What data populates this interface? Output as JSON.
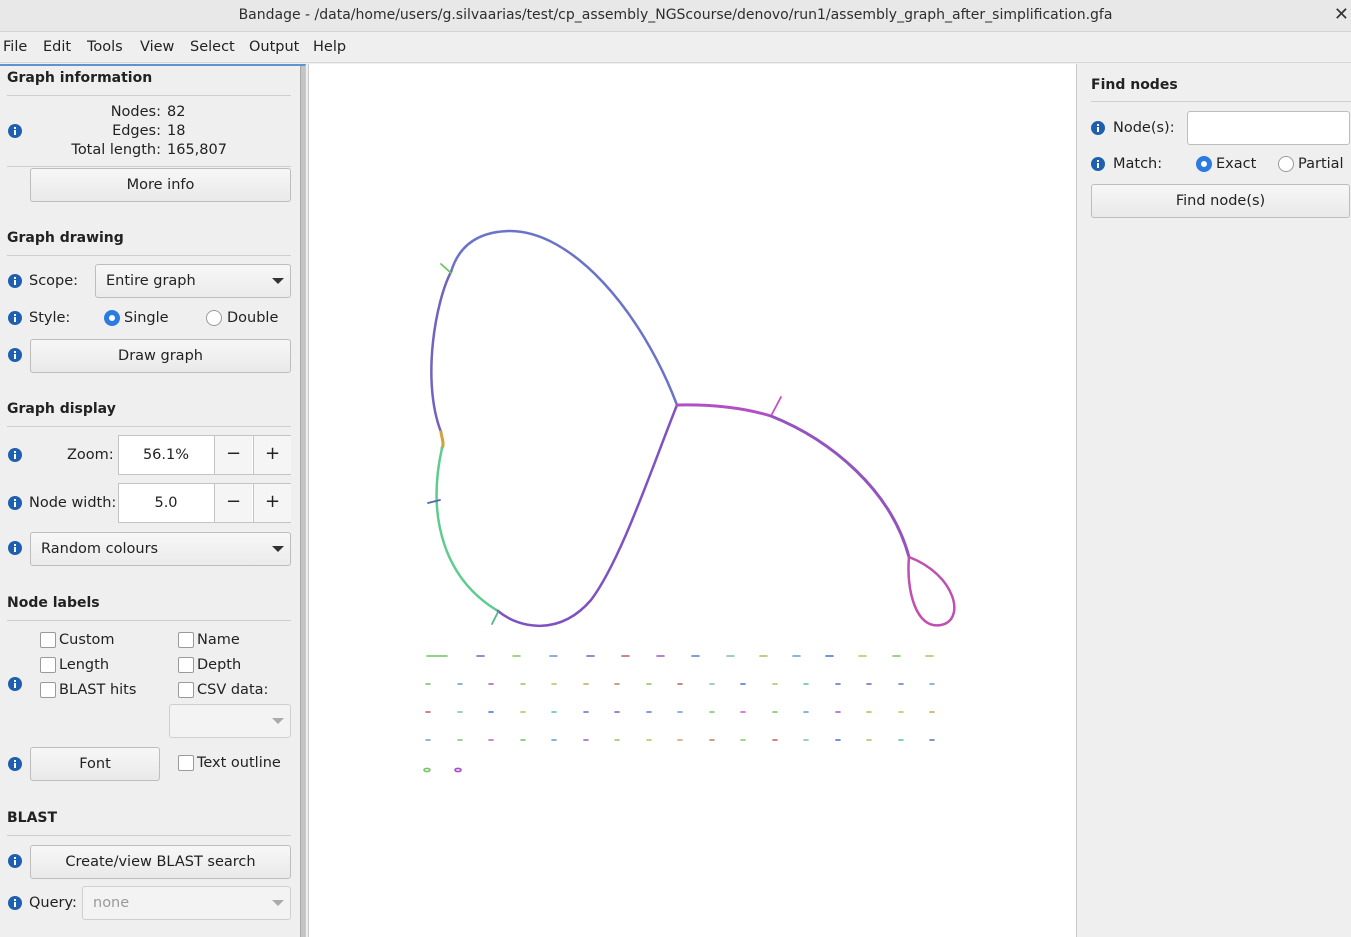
{
  "window": {
    "title": "Bandage - /data/home/users/g.silvaarias/test/cp_assembly_NGScourse/denovo/run1/assembly_graph_after_simplification.gfa",
    "close_glyph": "✕"
  },
  "menu": [
    "File",
    "Edit",
    "Tools",
    "View",
    "Select",
    "Output",
    "Help"
  ],
  "graph_information": {
    "title": "Graph information",
    "nodes_label": "Nodes:",
    "nodes_value": "82",
    "edges_label": "Edges:",
    "edges_value": "18",
    "length_label": "Total length:",
    "length_value": "165,807",
    "more_info_button": "More info"
  },
  "graph_drawing": {
    "title": "Graph drawing",
    "scope_label": "Scope:",
    "scope_value": "Entire graph",
    "style_label": "Style:",
    "style_single": "Single",
    "style_double": "Double",
    "style_selected": "Single",
    "draw_button": "Draw graph"
  },
  "graph_display": {
    "title": "Graph display",
    "zoom_label": "Zoom:",
    "zoom_value": "56.1%",
    "node_width_label": "Node width:",
    "node_width_value": "5.0",
    "minus_glyph": "−",
    "plus_glyph": "+",
    "colour_scheme": "Random colours"
  },
  "node_labels": {
    "title": "Node labels",
    "custom": "Custom",
    "name": "Name",
    "length": "Length",
    "depth": "Depth",
    "blast_hits": "BLAST hits",
    "csv_data": "CSV data:",
    "font_button": "Font",
    "text_outline": "Text outline"
  },
  "blast": {
    "title": "BLAST",
    "create_button": "Create/view BLAST search",
    "query_label": "Query:",
    "query_value": "none"
  },
  "find_nodes": {
    "title": "Find nodes",
    "nodes_label": "Node(s):",
    "nodes_value": "",
    "match_label": "Match:",
    "match_exact": "Exact",
    "match_partial": "Partial",
    "match_selected": "Exact",
    "find_button": "Find node(s)"
  },
  "colors": {
    "info_icon": "#1f5fb0",
    "radio_accent": "#2c7be0",
    "selection_border": "#5e93d0"
  }
}
